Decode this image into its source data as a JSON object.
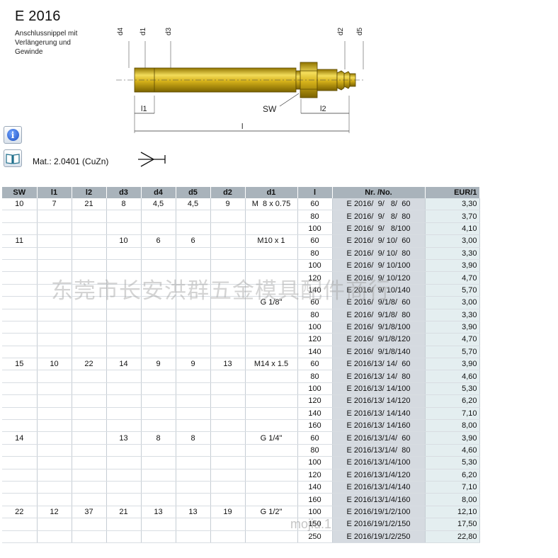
{
  "header": {
    "title": "E 2016",
    "description": [
      "Anschlussnippel mit",
      "Verlängerung und",
      "Gewinde"
    ]
  },
  "drawing": {
    "labels": {
      "d4": "d4",
      "d1": "d1",
      "d3": "d3",
      "d2": "d2",
      "d5": "d5",
      "l1": "l1",
      "l2": "l2",
      "l": "l",
      "sw": "SW"
    },
    "colors": {
      "body": "#d6b21a",
      "body_highlight": "#f3dd5a",
      "body_shadow": "#8f7300"
    }
  },
  "toolbar": {
    "info_icon": "info-icon",
    "book_icon": "book-icon"
  },
  "material": {
    "text": "Mat.: 2.0401 (CuZn)"
  },
  "table": {
    "headers": [
      "SW",
      "l1",
      "l2",
      "d3",
      "d4",
      "d5",
      "d2",
      "d1",
      "l",
      "Nr. /No.",
      "EUR/1"
    ],
    "rows": [
      [
        "10",
        "7",
        "21",
        "8",
        "4,5",
        "4,5",
        "9",
        "M  8 x 0.75",
        "60",
        "E 2016/  9/   8/  60",
        "3,30"
      ],
      [
        "",
        "",
        "",
        "",
        "",
        "",
        "",
        "",
        "80",
        "E 2016/  9/   8/  80",
        "3,70"
      ],
      [
        "",
        "",
        "",
        "",
        "",
        "",
        "",
        "",
        "100",
        "E 2016/  9/   8/100",
        "4,10"
      ],
      [
        "11",
        "",
        "",
        "10",
        "6",
        "6",
        "",
        "M10 x 1",
        "60",
        "E 2016/  9/ 10/  60",
        "3,00"
      ],
      [
        "",
        "",
        "",
        "",
        "",
        "",
        "",
        "",
        "80",
        "E 2016/  9/ 10/  80",
        "3,30"
      ],
      [
        "",
        "",
        "",
        "",
        "",
        "",
        "",
        "",
        "100",
        "E 2016/  9/ 10/100",
        "3,90"
      ],
      [
        "",
        "",
        "",
        "",
        "",
        "",
        "",
        "",
        "120",
        "E 2016/  9/ 10/120",
        "4,70"
      ],
      [
        "",
        "",
        "",
        "",
        "",
        "",
        "",
        "",
        "140",
        "E 2016/  9/ 10/140",
        "5,70"
      ],
      [
        "",
        "",
        "",
        "",
        "",
        "",
        "",
        "G 1/8\"",
        "60",
        "E 2016/  9/1/8/  60",
        "3,00"
      ],
      [
        "",
        "",
        "",
        "",
        "",
        "",
        "",
        "",
        "80",
        "E 2016/  9/1/8/  80",
        "3,30"
      ],
      [
        "",
        "",
        "",
        "",
        "",
        "",
        "",
        "",
        "100",
        "E 2016/  9/1/8/100",
        "3,90"
      ],
      [
        "",
        "",
        "",
        "",
        "",
        "",
        "",
        "",
        "120",
        "E 2016/  9/1/8/120",
        "4,70"
      ],
      [
        "",
        "",
        "",
        "",
        "",
        "",
        "",
        "",
        "140",
        "E 2016/  9/1/8/140",
        "5,70"
      ],
      [
        "15",
        "10",
        "22",
        "14",
        "9",
        "9",
        "13",
        "M14 x 1.5",
        "60",
        "E 2016/13/ 14/  60",
        "3,90"
      ],
      [
        "",
        "",
        "",
        "",
        "",
        "",
        "",
        "",
        "80",
        "E 2016/13/ 14/  80",
        "4,60"
      ],
      [
        "",
        "",
        "",
        "",
        "",
        "",
        "",
        "",
        "100",
        "E 2016/13/ 14/100",
        "5,30"
      ],
      [
        "",
        "",
        "",
        "",
        "",
        "",
        "",
        "",
        "120",
        "E 2016/13/ 14/120",
        "6,20"
      ],
      [
        "",
        "",
        "",
        "",
        "",
        "",
        "",
        "",
        "140",
        "E 2016/13/ 14/140",
        "7,10"
      ],
      [
        "",
        "",
        "",
        "",
        "",
        "",
        "",
        "",
        "160",
        "E 2016/13/ 14/160",
        "8,00"
      ],
      [
        "14",
        "",
        "",
        "13",
        "8",
        "8",
        "",
        "G 1/4\"",
        "60",
        "E 2016/13/1/4/  60",
        "3,90"
      ],
      [
        "",
        "",
        "",
        "",
        "",
        "",
        "",
        "",
        "80",
        "E 2016/13/1/4/  80",
        "4,60"
      ],
      [
        "",
        "",
        "",
        "",
        "",
        "",
        "",
        "",
        "100",
        "E 2016/13/1/4/100",
        "5,30"
      ],
      [
        "",
        "",
        "",
        "",
        "",
        "",
        "",
        "",
        "120",
        "E 2016/13/1/4/120",
        "6,20"
      ],
      [
        "",
        "",
        "",
        "",
        "",
        "",
        "",
        "",
        "140",
        "E 2016/13/1/4/140",
        "7,10"
      ],
      [
        "",
        "",
        "",
        "",
        "",
        "",
        "",
        "",
        "160",
        "E 2016/13/1/4/160",
        "8,00"
      ],
      [
        "22",
        "12",
        "37",
        "21",
        "13",
        "13",
        "19",
        "G 1/2\"",
        "100",
        "E 2016/19/1/2/100",
        "12,10"
      ],
      [
        "",
        "",
        "",
        "",
        "",
        "",
        "",
        "",
        "150",
        "E 2016/19/1/2/150",
        "17,50"
      ],
      [
        "",
        "",
        "",
        "",
        "",
        "",
        "",
        "",
        "250",
        "E 2016/19/1/2/250",
        "22,80"
      ]
    ]
  },
  "watermark": {
    "text": "东莞市长安洪群五金模具配件商行",
    "text2": "mojiu.1"
  }
}
